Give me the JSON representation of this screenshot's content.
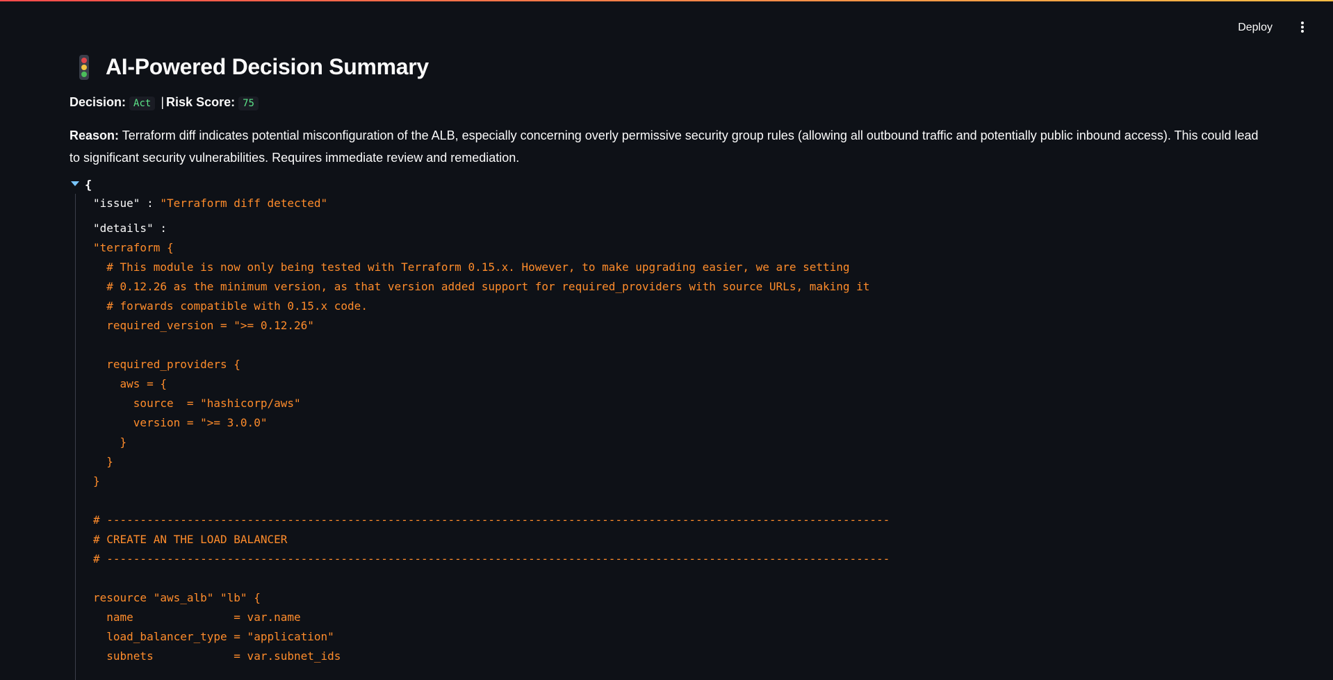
{
  "header": {
    "deploy_label": "Deploy"
  },
  "page": {
    "title": "AI-Powered Decision Summary",
    "decision_label": "Decision:",
    "decision_value": "Act",
    "separator": "|",
    "risk_label": "Risk Score:",
    "risk_value": "75",
    "reason_label": "Reason:",
    "reason_text": " Terraform diff indicates potential misconfiguration of the ALB, especially concerning overly permissive security group rules (allowing all outbound traffic and potentially public inbound access). This could lead to significant security vulnerabilities. Requires immediate review and remediation."
  },
  "json_view": {
    "open_brace": "{",
    "issue_key": "\"issue\"",
    "issue_value": "\"Terraform diff detected\"",
    "details_key": "\"details\"",
    "colon": " : ",
    "details_value": "\"terraform {\n  # This module is now only being tested with Terraform 0.15.x. However, to make upgrading easier, we are setting\n  # 0.12.26 as the minimum version, as that version added support for required_providers with source URLs, making it\n  # forwards compatible with 0.15.x code.\n  required_version = \">= 0.12.26\"\n\n  required_providers {\n    aws = {\n      source  = \"hashicorp/aws\"\n      version = \">= 3.0.0\"\n    }\n  }\n}\n\n# ---------------------------------------------------------------------------------------------------------------------\n# CREATE AN THE LOAD BALANCER\n# ---------------------------------------------------------------------------------------------------------------------\n\nresource \"aws_alb\" \"lb\" {\n  name               = var.name\n  load_balancer_type = \"application\"\n  subnets            = var.subnet_ids"
  },
  "colors": {
    "background": "#0e1117",
    "string": "#ff8c2b",
    "chip_text": "#5ce488",
    "toggle": "#79c6ff"
  }
}
